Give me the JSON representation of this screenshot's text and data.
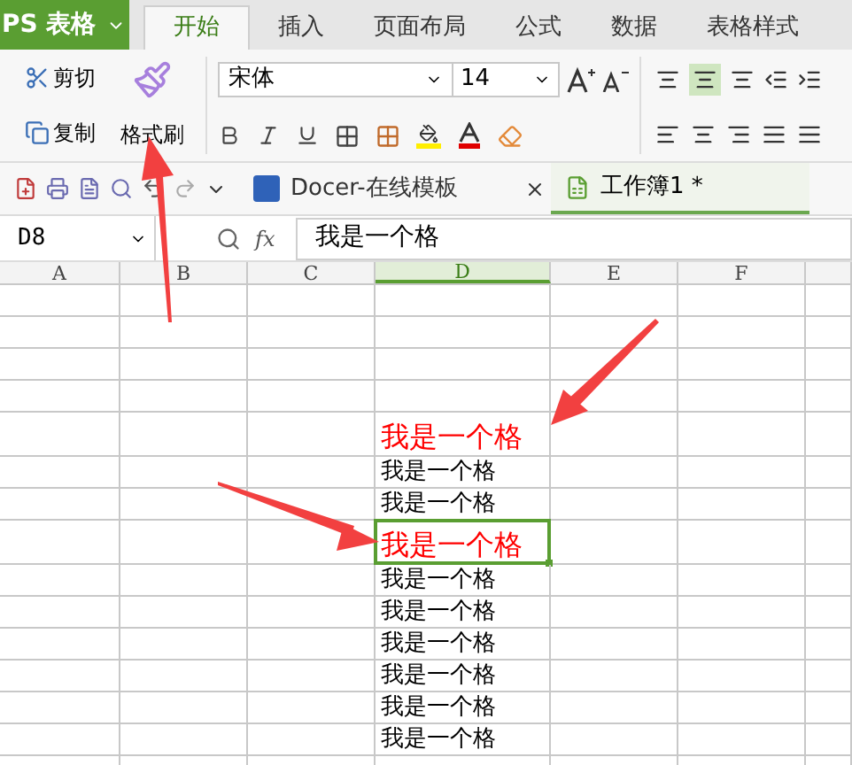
{
  "app_button": {
    "label": "PS 表格"
  },
  "tabs": [
    {
      "label": "开始",
      "selected": true
    },
    {
      "label": "插入",
      "selected": false
    },
    {
      "label": "页面布局",
      "selected": false
    },
    {
      "label": "公式",
      "selected": false
    },
    {
      "label": "数据",
      "selected": false
    },
    {
      "label": "表格样式",
      "selected": false
    }
  ],
  "clipboard": {
    "cut": "剪切",
    "copy": "复制",
    "format_painter": "格式刷"
  },
  "font": {
    "name": "宋体",
    "size": "14"
  },
  "doc_tabs": [
    {
      "label": "Docer-在线模板",
      "selected": false
    },
    {
      "label": "工作簿1 *",
      "selected": true
    }
  ],
  "name_box": "D8",
  "function_label": "fx",
  "formula": "我是一个格",
  "columns": [
    {
      "label": "A",
      "selected": false
    },
    {
      "label": "B",
      "selected": false
    },
    {
      "label": "C",
      "selected": false
    },
    {
      "label": "D",
      "selected": true
    },
    {
      "label": "E",
      "selected": false
    },
    {
      "label": "F",
      "selected": false
    }
  ],
  "rows": [
    {
      "kind": "empty",
      "selected": false
    },
    {
      "kind": "empty",
      "selected": false
    },
    {
      "kind": "empty",
      "selected": false
    },
    {
      "kind": "empty",
      "selected": false
    },
    {
      "kind": "large",
      "text": "我是一个格",
      "color": "#ff0000",
      "selected": false
    },
    {
      "kind": "plain",
      "text": "我是一个格",
      "color": "#000000",
      "selected": false
    },
    {
      "kind": "plain",
      "text": "我是一个格",
      "color": "#000000",
      "selected": false
    },
    {
      "kind": "large",
      "text": "我是一个格",
      "color": "#ff0000",
      "selected": true
    },
    {
      "kind": "plain",
      "text": "我是一个格",
      "color": "#000000",
      "selected": false
    },
    {
      "kind": "plain",
      "text": "我是一个格",
      "color": "#000000",
      "selected": false
    },
    {
      "kind": "plain",
      "text": "我是一个格",
      "color": "#000000",
      "selected": false
    },
    {
      "kind": "plain",
      "text": "我是一个格",
      "color": "#000000",
      "selected": false
    },
    {
      "kind": "plain",
      "text": "我是一个格",
      "color": "#000000",
      "selected": false
    },
    {
      "kind": "plain",
      "text": "我是一个格",
      "color": "#000000",
      "selected": false
    },
    {
      "kind": "empty",
      "selected": false
    }
  ]
}
